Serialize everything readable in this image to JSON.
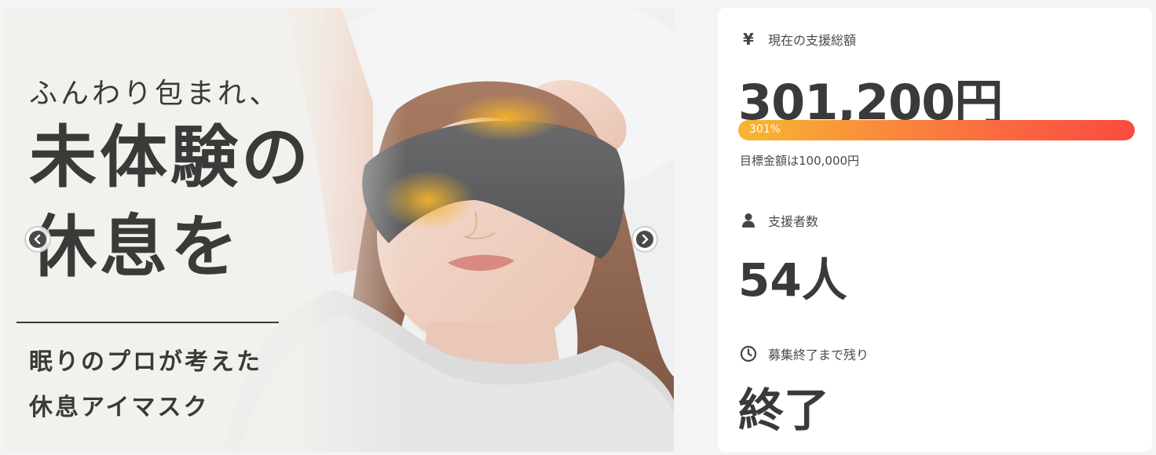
{
  "hero": {
    "line1": "ふんわり包まれ、",
    "line2": "未体験の",
    "line3": "休息を",
    "line4": "眠りのプロが考えた",
    "line5": "休息アイマスク",
    "prev_icon": "chevron-left-icon",
    "next_icon": "chevron-right-icon"
  },
  "stats": {
    "total": {
      "icon": "yen-icon",
      "icon_glyph": "¥",
      "label": "現在の支援総額",
      "value": "301,200円",
      "progress_label": "301%",
      "progress_fraction": 1.0,
      "goal": "目標金額は100,000円"
    },
    "supporters": {
      "icon": "person-icon",
      "label": "支援者数",
      "value": "54人"
    },
    "remaining": {
      "icon": "clock-icon",
      "label": "募集終了まで残り",
      "value": "終了"
    }
  },
  "colors": {
    "progress_start": "#f7b731",
    "progress_end": "#fa4b3e",
    "text": "#3a3a3a",
    "card_bg": "#ffffff"
  }
}
